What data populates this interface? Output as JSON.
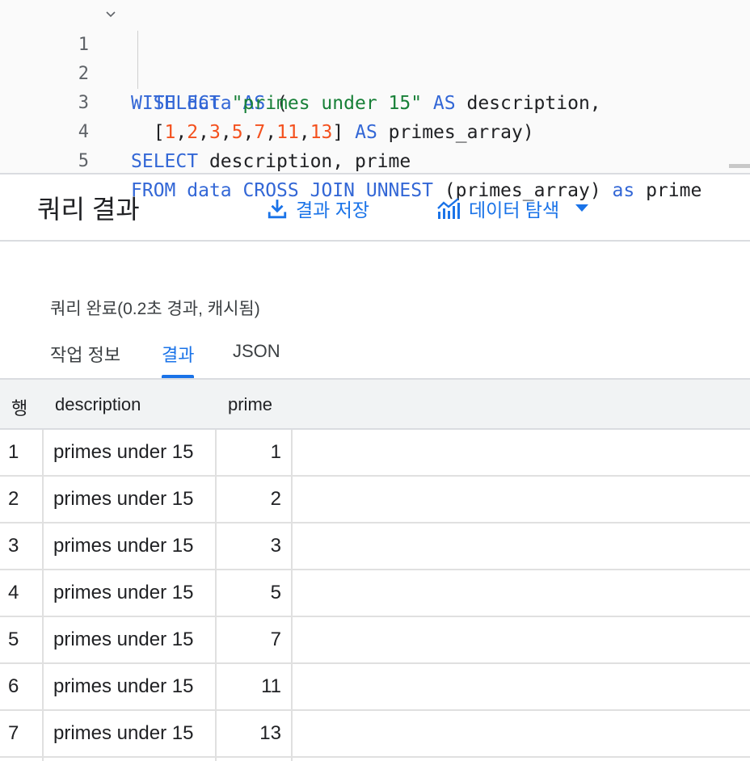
{
  "editor": {
    "lines": [
      {
        "n": "1",
        "tokens": [
          [
            "kw",
            "WITH"
          ],
          [
            "p",
            " "
          ],
          [
            "kw",
            "data"
          ],
          [
            "p",
            " "
          ],
          [
            "kw",
            "AS"
          ],
          [
            "p",
            " ("
          ]
        ]
      },
      {
        "n": "2",
        "tokens": [
          [
            "p",
            "  "
          ],
          [
            "kw",
            "SELECT"
          ],
          [
            "p",
            " "
          ],
          [
            "str",
            "\"primes under 15\""
          ],
          [
            "p",
            " "
          ],
          [
            "kw",
            "AS"
          ],
          [
            "p",
            " description,"
          ]
        ]
      },
      {
        "n": "3",
        "tokens": [
          [
            "p",
            "  ["
          ],
          [
            "num",
            "1"
          ],
          [
            "p",
            ","
          ],
          [
            "num",
            "2"
          ],
          [
            "p",
            ","
          ],
          [
            "num",
            "3"
          ],
          [
            "p",
            ","
          ],
          [
            "num",
            "5"
          ],
          [
            "p",
            ","
          ],
          [
            "num",
            "7"
          ],
          [
            "p",
            ","
          ],
          [
            "num",
            "11"
          ],
          [
            "p",
            ","
          ],
          [
            "num",
            "13"
          ],
          [
            "p",
            "] "
          ],
          [
            "kw",
            "AS"
          ],
          [
            "p",
            " primes_array)"
          ]
        ]
      },
      {
        "n": "4",
        "tokens": [
          [
            "kw",
            "SELECT"
          ],
          [
            "p",
            " description, prime"
          ]
        ]
      },
      {
        "n": "5",
        "tokens": [
          [
            "kw",
            "FROM"
          ],
          [
            "p",
            " "
          ],
          [
            "kw",
            "data"
          ],
          [
            "p",
            " "
          ],
          [
            "kw",
            "CROSS"
          ],
          [
            "p",
            " "
          ],
          [
            "kw",
            "JOIN"
          ],
          [
            "p",
            " "
          ],
          [
            "kw",
            "UNNEST"
          ],
          [
            "p",
            " (primes_array) "
          ],
          [
            "kw",
            "as"
          ],
          [
            "p",
            " prime"
          ]
        ]
      }
    ]
  },
  "results": {
    "title": "쿼리 결과",
    "save_label": "결과 저장",
    "explore_label": "데이터 탐색"
  },
  "status": "쿼리 완료(0.2초 경과, 캐시됨)",
  "tabs": [
    {
      "label": "작업 정보",
      "active": false
    },
    {
      "label": "결과",
      "active": true
    },
    {
      "label": "JSON",
      "active": false
    }
  ],
  "table": {
    "headers": {
      "row": "행",
      "description": "description",
      "prime": "prime"
    },
    "rows": [
      {
        "row": "1",
        "description": "primes under 15",
        "prime": "1"
      },
      {
        "row": "2",
        "description": "primes under 15",
        "prime": "2"
      },
      {
        "row": "3",
        "description": "primes under 15",
        "prime": "3"
      },
      {
        "row": "4",
        "description": "primes under 15",
        "prime": "5"
      },
      {
        "row": "5",
        "description": "primes under 15",
        "prime": "7"
      },
      {
        "row": "6",
        "description": "primes under 15",
        "prime": "11"
      },
      {
        "row": "7",
        "description": "primes under 15",
        "prime": "13"
      }
    ]
  },
  "colors": {
    "accent": "#1a73e8",
    "keyword": "#3367d6",
    "string": "#188038",
    "number": "#f4511e"
  }
}
